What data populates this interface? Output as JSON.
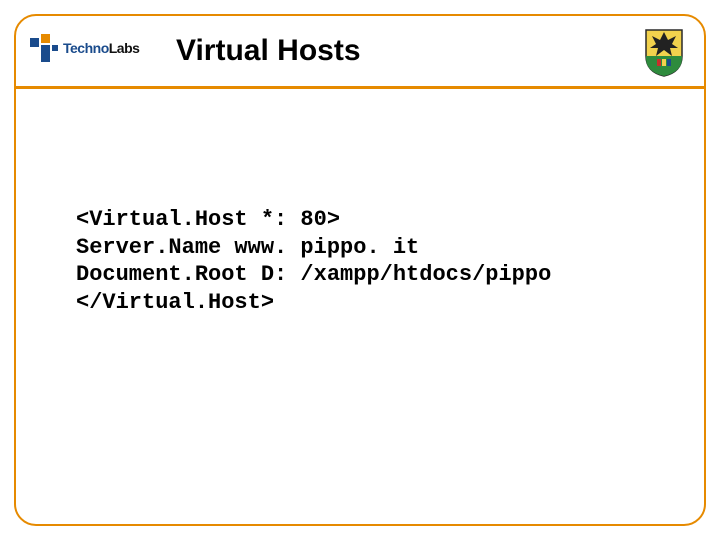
{
  "header": {
    "logo_primary": "Techno",
    "logo_secondary": "Labs",
    "title": "Virtual Hosts"
  },
  "content": {
    "lines": [
      "<Virtual.Host *: 80>",
      "Server.Name www. pippo. it",
      "Document.Root D: /xampp/htdocs/pippo",
      "</Virtual.Host>"
    ]
  },
  "colors": {
    "frame": "#e68a00",
    "logo_blue": "#1a4b8c"
  }
}
